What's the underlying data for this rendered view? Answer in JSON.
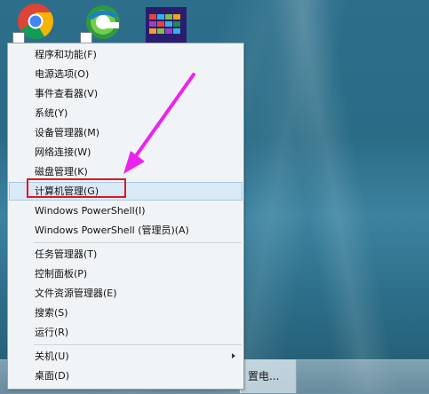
{
  "desktop": {
    "icons": [
      {
        "name": "Google Chrome",
        "icon": "chrome-icon"
      },
      {
        "name": "Internet Explorer",
        "icon": "ie-icon"
      },
      {
        "name": "Start tiles",
        "icon": "tiles-icon"
      }
    ]
  },
  "context_menu": {
    "items": [
      {
        "label": "程序和功能(F)"
      },
      {
        "label": "电源选项(O)"
      },
      {
        "label": "事件查看器(V)"
      },
      {
        "label": "系统(Y)"
      },
      {
        "label": "设备管理器(M)"
      },
      {
        "label": "网络连接(W)"
      },
      {
        "label": "磁盘管理(K)"
      },
      {
        "label": "计算机管理(G)",
        "highlighted": true
      },
      {
        "label": "Windows PowerShell(I)"
      },
      {
        "label": "Windows PowerShell (管理员)(A)"
      },
      {
        "label": "任务管理器(T)"
      },
      {
        "label": "控制面板(P)"
      },
      {
        "label": "文件资源管理器(E)"
      },
      {
        "label": "搜索(S)"
      },
      {
        "label": "运行(R)"
      },
      {
        "label": "关机(U)",
        "has_submenu": true
      },
      {
        "label": "桌面(D)"
      }
    ]
  },
  "taskbar": {
    "item_label": "置电..."
  },
  "colors": {
    "highlight_border": "#e0161f",
    "annotation_arrow": "#ee22ee",
    "hover_background": "#dbe9f6"
  }
}
